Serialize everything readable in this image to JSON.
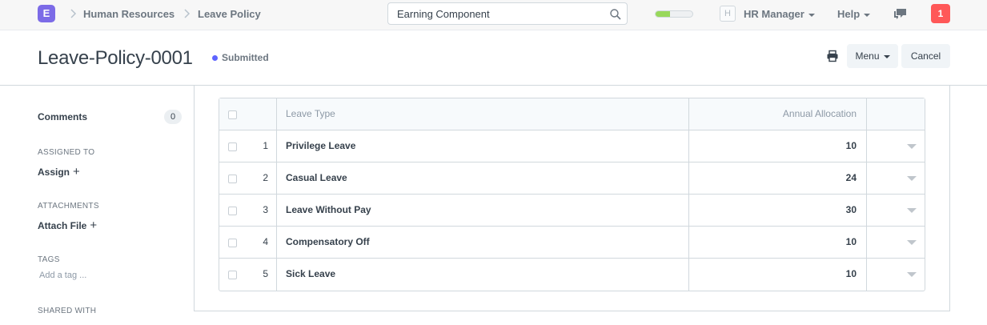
{
  "navbar": {
    "logo_letter": "E",
    "breadcrumbs": [
      "Human Resources",
      "Leave Policy"
    ],
    "search_value": "Earning Component",
    "progress_fraction": 0.4,
    "avatar_letter": "H",
    "user_menu": "HR Manager",
    "help_menu": "Help",
    "notification_count": "1",
    "colors": {
      "logo": "#7c6be7",
      "progress": "#98d85b",
      "notification": "#ff5858"
    }
  },
  "header": {
    "title": "Leave-Policy-0001",
    "status": "Submitted",
    "menu_button": "Menu",
    "cancel_button": "Cancel",
    "status_color": "#5e64ff"
  },
  "sidebar": {
    "comments_label": "Comments",
    "comments_count": "0",
    "assigned_to_label": "ASSIGNED TO",
    "assign_link": "Assign",
    "attachments_label": "ATTACHMENTS",
    "attach_link": "Attach File",
    "tags_label": "TAGS",
    "tag_placeholder": "Add a tag ...",
    "shared_with_label": "SHARED WITH"
  },
  "table": {
    "columns": [
      "Leave Type",
      "Annual Allocation"
    ],
    "rows": [
      {
        "idx": "1",
        "leave_type": "Privilege Leave",
        "allocation": "10"
      },
      {
        "idx": "2",
        "leave_type": "Casual Leave",
        "allocation": "24"
      },
      {
        "idx": "3",
        "leave_type": "Leave Without Pay",
        "allocation": "30"
      },
      {
        "idx": "4",
        "leave_type": "Compensatory Off",
        "allocation": "10"
      },
      {
        "idx": "5",
        "leave_type": "Sick Leave",
        "allocation": "10"
      }
    ]
  }
}
